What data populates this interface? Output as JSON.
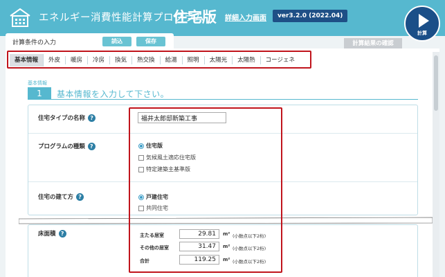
{
  "header": {
    "app_title": "エネルギー消費性能計算プログラム",
    "app_edition": "住宅版",
    "detail_link": "詳細入力画面",
    "version": "ver3.2.0 (2022.04)",
    "calc_label": "計算",
    "bg_color": "#56b8cf",
    "accent_color": "#1b4f88"
  },
  "input_panel": {
    "title": "計算条件の入力",
    "load_label": "読込",
    "save_label": "保存"
  },
  "results_label": "計算結果の確認",
  "tabs": [
    {
      "label": "基本情報",
      "active": true
    },
    {
      "label": "外皮"
    },
    {
      "label": "暖房"
    },
    {
      "label": "冷房"
    },
    {
      "label": "換気"
    },
    {
      "label": "熱交換"
    },
    {
      "label": "給湯"
    },
    {
      "label": "照明"
    },
    {
      "label": "太陽光"
    },
    {
      "label": "太陽熱"
    },
    {
      "label": "コージェネ"
    }
  ],
  "step": {
    "label": "基本情報",
    "number": "1",
    "title": "基本情報を入力して下さい。"
  },
  "form": {
    "house_name": {
      "label": "住宅タイプの名称",
      "value": "福井太郎邸新築工事"
    },
    "program_type": {
      "label": "プログラムの種類",
      "options": [
        {
          "label": "住宅版",
          "selected": true
        },
        {
          "label": "気候風土適応住宅版"
        },
        {
          "label": "特定建築主基準版"
        }
      ]
    },
    "building_type": {
      "label": "住宅の建て方",
      "options": [
        {
          "label": "戸建住宅",
          "selected": true
        },
        {
          "label": "共同住宅"
        }
      ]
    },
    "floor_area": {
      "label": "床面積",
      "unit": "m²",
      "note": "(小数点以下2桁)",
      "rows": [
        {
          "label": "主たる居室",
          "value": "29.81"
        },
        {
          "label": "その他の居室",
          "value": "31.47"
        },
        {
          "label": "合計",
          "value": "119.25"
        }
      ]
    },
    "help_icon": "?"
  }
}
